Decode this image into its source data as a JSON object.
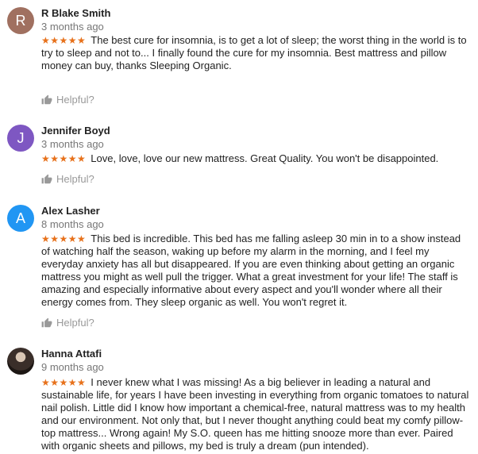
{
  "colors": {
    "star": "#e7711b",
    "muted": "#777777",
    "helpful": "#999999"
  },
  "reviews": [
    {
      "name": "R Blake Smith",
      "initial": "R",
      "avatar_color": "#a07060",
      "date": "3 months ago",
      "stars": "★★★★★",
      "rating": 5,
      "text": "The best cure for insomnia, is to get a lot of sleep; the worst thing in the world is to try to sleep and not to... I finally found the cure for my insomnia. Best mattress and pillow money can buy, thanks Sleeping Organic.",
      "helpful_label": "Helpful?"
    },
    {
      "name": "Jennifer Boyd",
      "initial": "J",
      "avatar_color": "#7e57c2",
      "date": "3 months ago",
      "stars": "★★★★★",
      "rating": 5,
      "text": "Love, love, love our new mattress. Great Quality.  You won't be disappointed.",
      "helpful_label": "Helpful?"
    },
    {
      "name": "Alex Lasher",
      "initial": "A",
      "avatar_color": "#2196f3",
      "date": "8 months ago",
      "stars": "★★★★★",
      "rating": 5,
      "text": "This bed is incredible.  This bed has me falling asleep 30 min in to a show instead of watching half the season, waking up before my alarm in the morning, and I feel my everyday anxiety has all but disappeared.  If you are even thinking about getting an organic mattress you might as well pull the trigger.  What a great investment for your life! The staff is amazing and especially informative about every aspect and you'll wonder where all their energy comes from. They sleep organic as well.  You won't regret it.",
      "helpful_label": "Helpful?"
    },
    {
      "name": "Hanna Attafi",
      "initial": "",
      "avatar_color": "#3a2e29",
      "date": "9 months ago",
      "stars": "★★★★★",
      "rating": 5,
      "text": "I never knew what I was missing! As a big believer in leading a natural and sustainable life, for years I have been investing in everything from organic tomatoes to natural nail polish. Little did I know how important a chemical-free, natural mattress was to my health and our environment. Not only that, but I never thought anything could beat my comfy pillow-top mattress... Wrong again! My S.O. queen has me hitting snooze more than ever. Paired with organic sheets and pillows, my bed is truly a dream (pun intended).",
      "helpful_label": ""
    }
  ]
}
